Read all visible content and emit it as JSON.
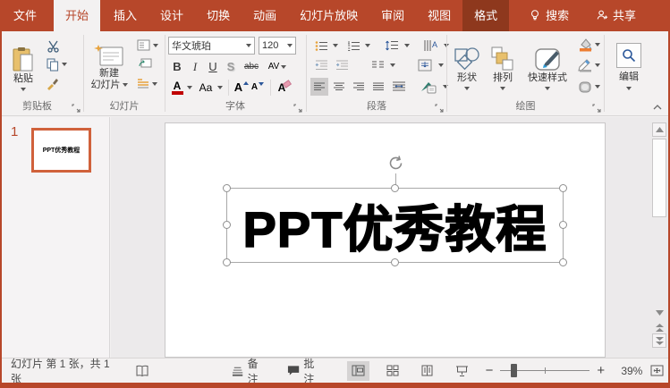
{
  "colors": {
    "accent": "#b7472a",
    "format_tab": "#8e381d",
    "thumb_border": "#d0613b",
    "fill_orange": "#ed7d31"
  },
  "titlebar": {
    "tabs": [
      "文件",
      "开始",
      "插入",
      "设计",
      "切换",
      "动画",
      "幻灯片放映",
      "审阅",
      "视图",
      "格式"
    ],
    "search": "搜索",
    "share": "共享"
  },
  "ribbon": {
    "clipboard": {
      "paste": "粘贴",
      "group_label": "剪贴板"
    },
    "slides": {
      "new_slide_line1": "新建",
      "new_slide_line2": "幻灯片",
      "group_label": "幻灯片"
    },
    "font": {
      "name": "华文琥珀",
      "size": "120",
      "bold": "B",
      "italic": "I",
      "underline": "U",
      "shadow": "S",
      "strikethrough": "abc",
      "spacing": "AV",
      "font_color": "A",
      "change_case": "Aa",
      "grow_font": "A",
      "shrink_font": "A",
      "clear_format": "A",
      "group_label": "字体"
    },
    "paragraph": {
      "group_label": "段落"
    },
    "drawing": {
      "shapes": "形状",
      "arrange": "排列",
      "quick_styles": "快速样式",
      "group_label": "绘图"
    },
    "editing": {
      "label": "编辑"
    }
  },
  "slides_panel": {
    "slide_number": "1",
    "thumbnail_text": "PPT优秀教程"
  },
  "slide": {
    "text": "PPT优秀教程"
  },
  "statusbar": {
    "slide_info": "幻灯片 第 1 张，共 1 张",
    "notes": "备注",
    "comments": "批注",
    "zoom_out": "−",
    "zoom_in": "+",
    "zoom": "39%"
  }
}
